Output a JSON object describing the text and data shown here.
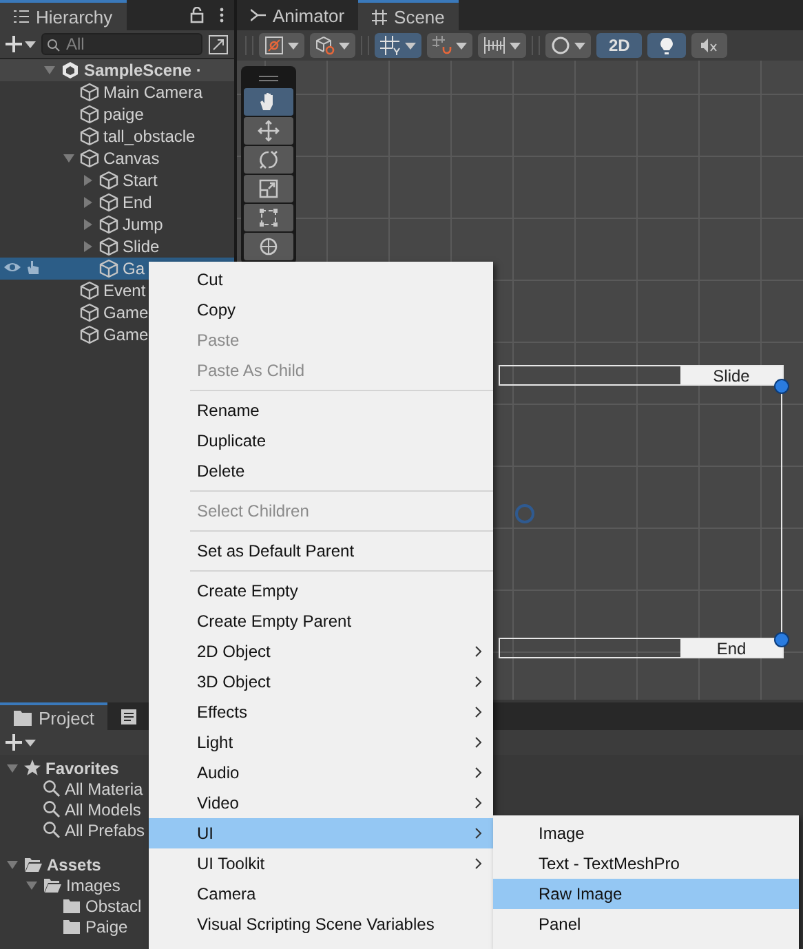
{
  "hierarchy": {
    "tab": "Hierarchy",
    "search": {
      "placeholder": "All"
    },
    "items": [
      {
        "label": "SampleScene ·",
        "kind": "scene",
        "expanded": true,
        "selected": false,
        "children": [
          {
            "label": "Main Camera",
            "kind": "object",
            "selected": false
          },
          {
            "label": "paige",
            "kind": "object",
            "selected": false
          },
          {
            "label": "tall_obstacle",
            "kind": "object",
            "selected": false
          },
          {
            "label": "Canvas",
            "kind": "object",
            "expanded": true,
            "selected": false,
            "children": [
              {
                "label": "Start",
                "kind": "object",
                "expanded": false,
                "selected": false
              },
              {
                "label": "End",
                "kind": "object",
                "expanded": false,
                "selected": false
              },
              {
                "label": "Jump",
                "kind": "object",
                "expanded": false,
                "selected": false
              },
              {
                "label": "Slide",
                "kind": "object",
                "expanded": false,
                "selected": false
              },
              {
                "label": "Ga",
                "kind": "object",
                "selected": true
              }
            ]
          },
          {
            "label": "Event",
            "kind": "object",
            "selected": false
          },
          {
            "label": "Game",
            "kind": "object",
            "selected": false
          },
          {
            "label": "Game",
            "kind": "object",
            "selected": false
          }
        ]
      }
    ]
  },
  "scene": {
    "tabs": [
      {
        "label": "Animator",
        "selected": false
      },
      {
        "label": "Scene",
        "selected": true
      }
    ],
    "toolbar": {
      "grid_snapping": {
        "on": true
      },
      "mode_2d": {
        "label": "2D",
        "on": true
      },
      "lighting": {
        "on": true
      },
      "audio": {
        "on": false
      }
    },
    "tools": [
      {
        "selected": true
      },
      {
        "selected": false
      },
      {
        "selected": false
      },
      {
        "selected": false
      },
      {
        "selected": false
      },
      {
        "selected": false
      }
    ],
    "labels": [
      {
        "text": "Slide"
      },
      {
        "text": "End"
      }
    ]
  },
  "project": {
    "tabs": [
      {
        "label": "Project",
        "selected": true
      },
      {
        "selected": false
      }
    ],
    "items": [
      {
        "label": "Favorites",
        "kind": "favorites",
        "expanded": true,
        "children": [
          {
            "label": "All Materia",
            "kind": "search"
          },
          {
            "label": "All Models",
            "kind": "search"
          },
          {
            "label": "All Prefabs",
            "kind": "search"
          }
        ]
      },
      {
        "label": "Assets",
        "kind": "folder",
        "expanded": true,
        "children": [
          {
            "label": "Images",
            "kind": "folder",
            "expanded": true,
            "children": [
              {
                "label": "Obstacl",
                "kind": "folder"
              },
              {
                "label": "Paige",
                "kind": "folder"
              }
            ]
          }
        ]
      }
    ]
  },
  "context_menu": {
    "items": [
      {
        "kind": "item",
        "label": "Cut",
        "disabled": false,
        "submenu": false,
        "selected": false
      },
      {
        "kind": "item",
        "label": "Copy",
        "disabled": false,
        "submenu": false,
        "selected": false
      },
      {
        "kind": "item",
        "label": "Paste",
        "disabled": true,
        "submenu": false,
        "selected": false
      },
      {
        "kind": "item",
        "label": "Paste As Child",
        "disabled": true,
        "submenu": false,
        "selected": false
      },
      {
        "kind": "separator"
      },
      {
        "kind": "item",
        "label": "Rename",
        "disabled": false,
        "submenu": false,
        "selected": false
      },
      {
        "kind": "item",
        "label": "Duplicate",
        "disabled": false,
        "submenu": false,
        "selected": false
      },
      {
        "kind": "item",
        "label": "Delete",
        "disabled": false,
        "submenu": false,
        "selected": false
      },
      {
        "kind": "separator"
      },
      {
        "kind": "item",
        "label": "Select Children",
        "disabled": true,
        "submenu": false,
        "selected": false
      },
      {
        "kind": "separator"
      },
      {
        "kind": "item",
        "label": "Set as Default Parent",
        "disabled": false,
        "submenu": false,
        "selected": false
      },
      {
        "kind": "separator"
      },
      {
        "kind": "item",
        "label": "Create Empty",
        "disabled": false,
        "submenu": false,
        "selected": false
      },
      {
        "kind": "item",
        "label": "Create Empty Parent",
        "disabled": false,
        "submenu": false,
        "selected": false
      },
      {
        "kind": "item",
        "label": "2D Object",
        "disabled": false,
        "submenu": true,
        "selected": false
      },
      {
        "kind": "item",
        "label": "3D Object",
        "disabled": false,
        "submenu": true,
        "selected": false
      },
      {
        "kind": "item",
        "label": "Effects",
        "disabled": false,
        "submenu": true,
        "selected": false
      },
      {
        "kind": "item",
        "label": "Light",
        "disabled": false,
        "submenu": true,
        "selected": false
      },
      {
        "kind": "item",
        "label": "Audio",
        "disabled": false,
        "submenu": true,
        "selected": false
      },
      {
        "kind": "item",
        "label": "Video",
        "disabled": false,
        "submenu": true,
        "selected": false
      },
      {
        "kind": "item",
        "label": "UI",
        "disabled": false,
        "submenu": true,
        "selected": true
      },
      {
        "kind": "item",
        "label": "UI Toolkit",
        "disabled": false,
        "submenu": true,
        "selected": false
      },
      {
        "kind": "item",
        "label": "Camera",
        "disabled": false,
        "submenu": false,
        "selected": false
      },
      {
        "kind": "item",
        "label": "Visual Scripting Scene Variables",
        "disabled": false,
        "submenu": false,
        "selected": false
      }
    ]
  },
  "submenu": {
    "items": [
      {
        "label": "Image",
        "selected": false
      },
      {
        "label": "Text - TextMeshPro",
        "selected": false
      },
      {
        "label": "Raw Image",
        "selected": true
      },
      {
        "label": "Panel",
        "selected": false
      }
    ]
  }
}
